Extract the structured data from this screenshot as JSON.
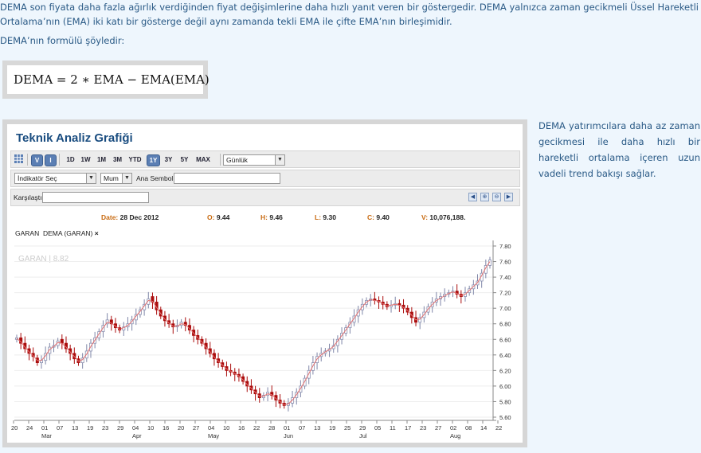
{
  "intro": {
    "paragraph1": "DEMA son fiyata daha fazla ağırlık verdiğinden fiyat değişimlerine daha hızlı yanıt veren bir göstergedir. DEMA yalnızca zaman gecikmeli Üssel Hareketli Ortalama’nın (EMA) iki katı bir gösterge değil aynı zamanda tekli EMA ile çifte EMA’nın birleşimidir.",
    "paragraph2": "DEMA’nın formülü şöyledir:",
    "formula": "DEMA = 2 ∗ EMA − EMA(EMA)"
  },
  "side_text": "DEMA yatırımcılara daha az zaman gecikmesi ile daha hızlı bir hareketli ortalama içeren uzun vadeli trend bakışı sağlar.",
  "widget": {
    "title": "Teknik Analiz Grafiği",
    "toolbar": {
      "v_label": "V",
      "i_label": "I",
      "ranges": [
        "1D",
        "1W",
        "1M",
        "3M",
        "YTD",
        "1Y",
        "3Y",
        "5Y",
        "MAX"
      ],
      "active_range": "1Y",
      "interval_value": "Günlük"
    },
    "indicator_bar": {
      "indicator_select": "İndikatör Seç",
      "type_select": "Mum",
      "main_symbol_label": "Ana Sembol",
      "main_symbol_value": ""
    },
    "compare_bar": {
      "compare_label": "Karşılaştır",
      "compare_value": ""
    },
    "ohlc": {
      "date_label": "Date:",
      "date": "28 Dec 2012",
      "open_label": "O:",
      "open": "9.44",
      "high_label": "H:",
      "high": "9.46",
      "low_label": "L:",
      "low": "9.30",
      "close_label": "C:",
      "close": "9.40",
      "volume_label": "V:",
      "volume": "10,076,188."
    },
    "legend": {
      "symbol": "GARAN",
      "indicator": "DEMA (GARAN)",
      "remove": "×"
    },
    "watermark": "GARAN | 8.82",
    "colors": {
      "up_candle": "#b8bfd8",
      "down_candle": "#aa0d0d",
      "dema_line": "#e27272",
      "accent": "#c86a10"
    }
  },
  "chart_data": {
    "type": "line",
    "title": "",
    "ylabel": "",
    "xlabel": "",
    "ylim": [
      5.6,
      7.8
    ],
    "yticks": [
      "7.80",
      "7.60",
      "7.40",
      "7.20",
      "7.00",
      "6.80",
      "6.60",
      "6.40",
      "6.20",
      "6.00",
      "5.80",
      "5.60"
    ],
    "x_ticks": [
      "20",
      "24",
      "01",
      "07",
      "13",
      "19",
      "23",
      "29",
      "04",
      "10",
      "16",
      "20",
      "27",
      "04",
      "10",
      "16",
      "22",
      "28",
      "01",
      "07",
      "13",
      "19",
      "25",
      "29",
      "05",
      "11",
      "17",
      "23",
      "27",
      "02",
      "08",
      "14",
      "22"
    ],
    "month_labels": [
      {
        "label": "Mar",
        "tick_index": 2
      },
      {
        "label": "Apr",
        "tick_index": 8
      },
      {
        "label": "May",
        "tick_index": 13
      },
      {
        "label": "Jun",
        "tick_index": 18
      },
      {
        "label": "Jul",
        "tick_index": 23
      },
      {
        "label": "Aug",
        "tick_index": 29
      }
    ],
    "series": [
      {
        "name": "GARAN",
        "close": [
          6.62,
          6.55,
          6.48,
          6.42,
          6.38,
          6.3,
          6.33,
          6.42,
          6.5,
          6.52,
          6.58,
          6.55,
          6.48,
          6.42,
          6.35,
          6.3,
          6.36,
          6.45,
          6.55,
          6.62,
          6.7,
          6.78,
          6.85,
          6.8,
          6.75,
          6.72,
          6.76,
          6.8,
          6.85,
          6.92,
          6.98,
          7.05,
          7.12,
          7.08,
          6.98,
          6.9,
          6.84,
          6.8,
          6.76,
          6.78,
          6.82,
          6.78,
          6.72,
          6.65,
          6.6,
          6.55,
          6.48,
          6.42,
          6.35,
          6.3,
          6.25,
          6.2,
          6.18,
          6.15,
          6.12,
          6.06,
          6.0,
          5.95,
          5.9,
          5.85,
          5.88,
          5.92,
          5.88,
          5.82,
          5.78,
          5.75,
          5.78,
          5.85,
          5.92,
          6.0,
          6.1,
          6.2,
          6.3,
          6.38,
          6.42,
          6.45,
          6.48,
          6.52,
          6.6,
          6.68,
          6.75,
          6.82,
          6.9,
          6.98,
          7.05,
          7.1,
          7.12,
          7.1,
          7.08,
          7.05,
          7.02,
          7.04,
          7.06,
          7.04,
          7.0,
          6.95,
          6.88,
          6.82,
          6.88,
          6.95,
          7.02,
          7.08,
          7.12,
          7.15,
          7.18,
          7.2,
          7.22,
          7.18,
          7.15,
          7.2,
          7.25,
          7.3,
          7.35,
          7.45,
          7.55,
          7.62
        ],
        "open": [
          6.6,
          6.62,
          6.55,
          6.48,
          6.42,
          6.36,
          6.3,
          6.33,
          6.42,
          6.5,
          6.52,
          6.6,
          6.55,
          6.48,
          6.42,
          6.35,
          6.3,
          6.36,
          6.45,
          6.55,
          6.62,
          6.7,
          6.8,
          6.85,
          6.8,
          6.75,
          6.72,
          6.76,
          6.8,
          6.85,
          6.92,
          6.98,
          7.05,
          7.15,
          7.08,
          6.98,
          6.9,
          6.84,
          6.8,
          6.76,
          6.78,
          6.82,
          6.78,
          6.72,
          6.65,
          6.6,
          6.55,
          6.48,
          6.42,
          6.35,
          6.3,
          6.25,
          6.2,
          6.18,
          6.15,
          6.12,
          6.06,
          6.0,
          5.95,
          5.9,
          5.85,
          5.88,
          5.92,
          5.88,
          5.82,
          5.78,
          5.75,
          5.78,
          5.85,
          5.92,
          6.0,
          6.1,
          6.2,
          6.3,
          6.38,
          6.42,
          6.45,
          6.48,
          6.52,
          6.6,
          6.68,
          6.75,
          6.82,
          6.9,
          6.98,
          7.05,
          7.1,
          7.12,
          7.1,
          7.08,
          7.05,
          7.02,
          7.04,
          7.06,
          7.04,
          7.0,
          6.95,
          6.88,
          6.82,
          6.88,
          6.95,
          7.02,
          7.08,
          7.12,
          7.15,
          7.18,
          7.22,
          7.22,
          7.18,
          7.15,
          7.2,
          7.25,
          7.3,
          7.35,
          7.45,
          7.55
        ]
      },
      {
        "name": "DEMA (GARAN)",
        "values": [
          6.61,
          6.57,
          6.5,
          6.44,
          6.39,
          6.33,
          6.33,
          6.39,
          6.47,
          6.51,
          6.56,
          6.55,
          6.5,
          6.44,
          6.38,
          6.32,
          6.34,
          6.41,
          6.51,
          6.59,
          6.67,
          6.75,
          6.82,
          6.81,
          6.77,
          6.73,
          6.75,
          6.78,
          6.83,
          6.9,
          6.96,
          7.03,
          7.1,
          7.09,
          7.01,
          6.93,
          6.86,
          6.81,
          6.77,
          6.77,
          6.8,
          6.79,
          6.74,
          6.68,
          6.62,
          6.57,
          6.5,
          6.44,
          6.37,
          6.32,
          6.27,
          6.22,
          6.19,
          6.16,
          6.13,
          6.08,
          6.02,
          5.97,
          5.92,
          5.87,
          5.87,
          5.9,
          5.89,
          5.84,
          5.8,
          5.76,
          5.77,
          5.82,
          5.89,
          5.97,
          6.06,
          6.16,
          6.26,
          6.35,
          6.4,
          6.44,
          6.47,
          6.51,
          6.58,
          6.65,
          6.72,
          6.8,
          6.87,
          6.95,
          7.02,
          7.08,
          7.11,
          7.1,
          7.09,
          7.06,
          7.03,
          7.04,
          7.05,
          7.04,
          7.01,
          6.97,
          6.91,
          6.85,
          6.86,
          6.92,
          6.99,
          7.05,
          7.1,
          7.13,
          7.16,
          7.19,
          7.21,
          7.19,
          7.16,
          7.18,
          7.23,
          7.28,
          7.33,
          7.42,
          7.52,
          7.6
        ]
      }
    ]
  }
}
